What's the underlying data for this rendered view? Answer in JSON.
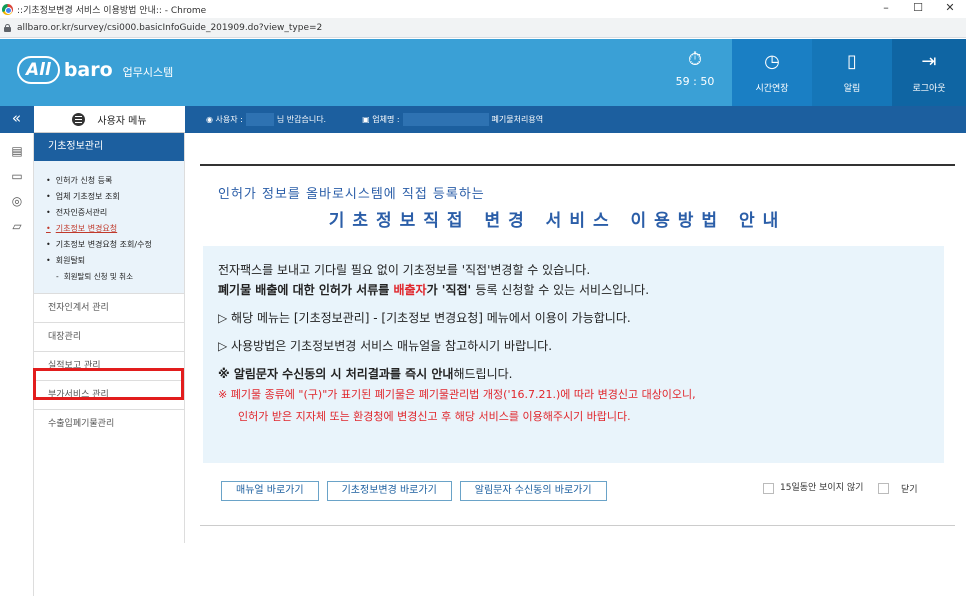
{
  "browser": {
    "title": "::기초정보변경 서비스 이용방법 안내:: - Chrome",
    "url": "allbaro.or.kr/survey/csi000.basicInfoGuide_201909.do?view_type=2",
    "controls": [
      "–",
      "☐",
      "✕"
    ]
  },
  "header": {
    "logo_all": "All",
    "logo_baro": "baro",
    "logo_sys": "업무시스템",
    "timer": "59 : 50",
    "buttons": [
      {
        "label": "시간연장",
        "icon": "clock-icon"
      },
      {
        "label": "알림",
        "icon": "bell-icon"
      },
      {
        "label": "로그아웃",
        "icon": "logout-icon"
      }
    ]
  },
  "infobar": {
    "collapse": "«",
    "user_menu": "사용자 메뉴",
    "user_prefix": "사용자 :",
    "user_suffix": "님 반갑습니다.",
    "company_prefix": "업체명 :",
    "company_suffix": "폐기물처리용역"
  },
  "sidebar": {
    "head": "기초정보관리",
    "sub_items": [
      "인허가 신청 등록",
      "업체 기초정보 조회",
      "전자인증서관리",
      "기초정보 변경요청",
      "기초정보 변경요청 조회/수정",
      "회원탈퇴",
      "회원탈퇴 신청 및 취소"
    ],
    "items": [
      "전자인계서 관리",
      "대장관리",
      "실적보고 관리",
      "부가서비스 관리",
      "수출입폐기물관리"
    ]
  },
  "content": {
    "intro_sub": "인허가 정보를 올바로시스템에 직접 등록하는",
    "intro_title": "기초정보직접 변경 서비스 이용방법 안내",
    "p1": "전자팩스를 보내고 기다릴 필요 없이 기초정보를 '직접'변경할 수 있습니다.",
    "p2a": "폐기물 배출에 대한 인허가 서류를 ",
    "p2b": "배출자",
    "p2c": "가 '직접' ",
    "p2d": "등록 신청할 수 있는 서비스입니다.",
    "p3": "▷ 해당 메뉴는 [기초정보관리] - [기초정보 변경요청] 메뉴에서 이용이 가능합니다.",
    "p4": "▷ 사용방법은 기초정보변경 서비스 매뉴얼을 참고하시기 바랍니다.",
    "p5a": "※ 알림문자 수신동의 시 처리결과를 즉시 안내",
    "p5b": "해드립니다.",
    "p6": "※ 폐기물 종류에 \"(구)\"가 표기된 폐기물은 폐기물관리법 개정('16.7.21.)에 따라 변경신고 대상이오니,",
    "p7": "인허가 받은 지자체 또는 환경청에 변경신고 후 해당 서비스를 이용해주시기 바랍니다."
  },
  "buttons": {
    "manual": "매뉴얼 바로가기",
    "basic_change": "기초정보변경 바로가기",
    "sms_consent": "알림문자 수신동의 바로가기"
  },
  "checks": {
    "hide_15": "15일동안 보이지 않기",
    "close": "닫기"
  }
}
